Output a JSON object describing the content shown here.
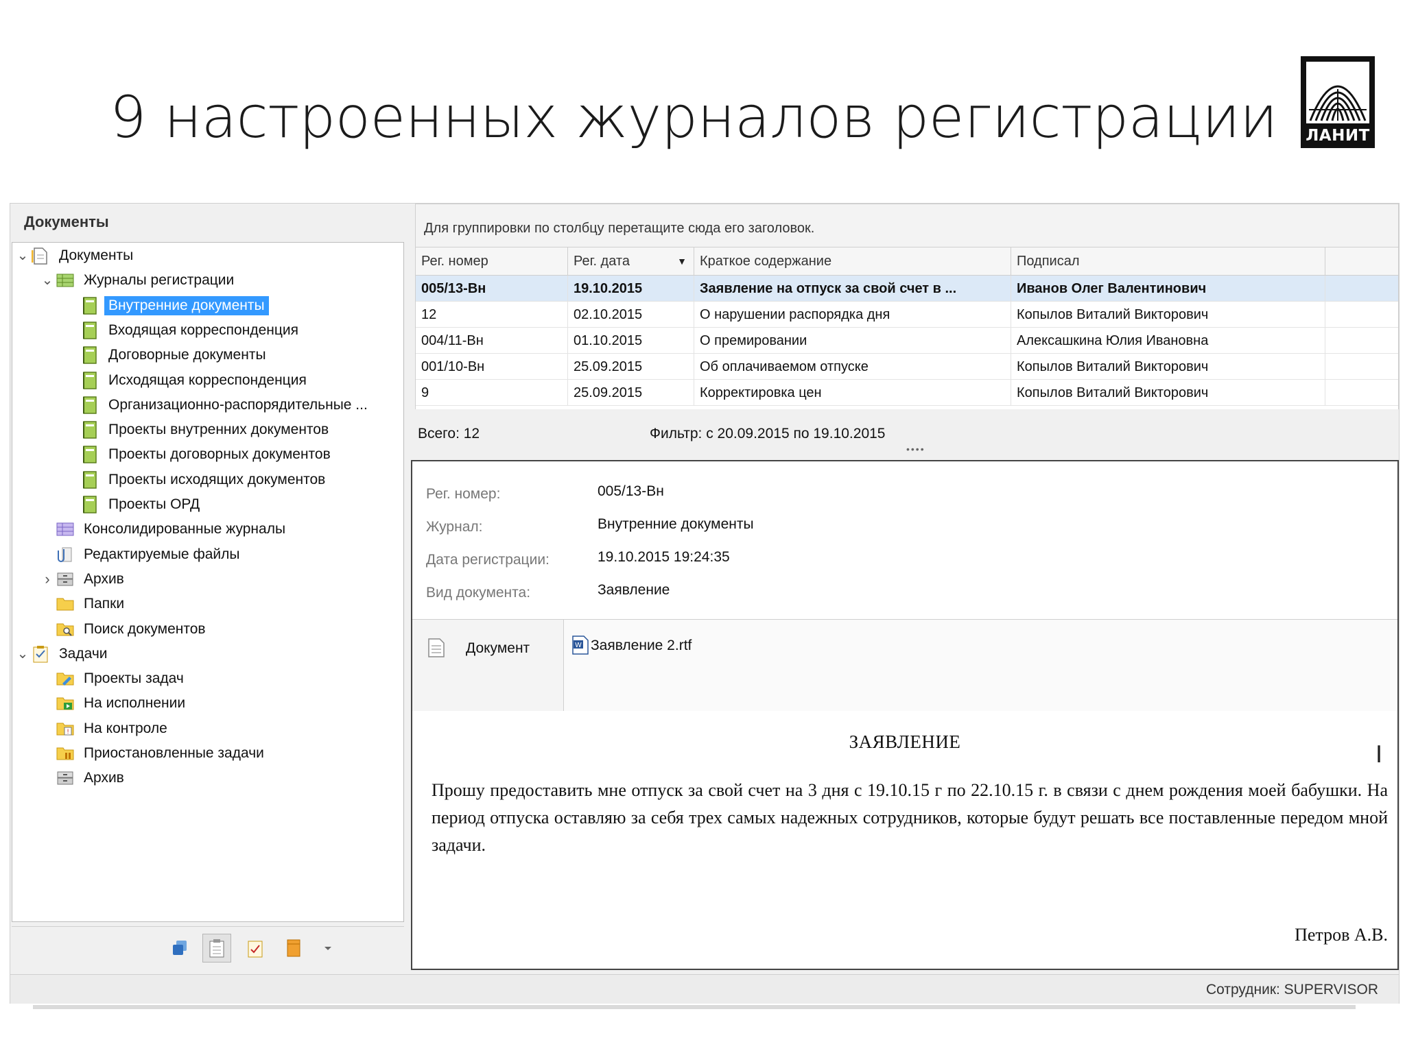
{
  "slide": {
    "title": "9 настроенных журналов регистрации"
  },
  "logo": {
    "text": "ЛАНИТ"
  },
  "app": {
    "left_panel": {
      "title": "Документы",
      "tree": [
        {
          "label": "Документы",
          "level": 0,
          "expander": "expanded",
          "icon": "documents-icon"
        },
        {
          "label": "Журналы регистрации",
          "level": 1,
          "expander": "expanded",
          "icon": "registration-journals-icon"
        },
        {
          "label": "Внутренние документы",
          "level": 2,
          "expander": "none",
          "icon": "journal-icon",
          "selected": true
        },
        {
          "label": "Входящая корреспонденция",
          "level": 2,
          "expander": "none",
          "icon": "journal-icon"
        },
        {
          "label": "Договорные документы",
          "level": 2,
          "expander": "none",
          "icon": "journal-icon"
        },
        {
          "label": "Исходящая корреспонденция",
          "level": 2,
          "expander": "none",
          "icon": "journal-icon"
        },
        {
          "label": "Организационно-распорядительные ...",
          "level": 2,
          "expander": "none",
          "icon": "journal-icon"
        },
        {
          "label": "Проекты внутренних документов",
          "level": 2,
          "expander": "none",
          "icon": "journal-icon"
        },
        {
          "label": "Проекты договорных документов",
          "level": 2,
          "expander": "none",
          "icon": "journal-icon"
        },
        {
          "label": "Проекты исходящих документов",
          "level": 2,
          "expander": "none",
          "icon": "journal-icon"
        },
        {
          "label": "Проекты ОРД",
          "level": 2,
          "expander": "none",
          "icon": "journal-icon"
        },
        {
          "label": "Консолидированные журналы",
          "level": 1,
          "expander": "none",
          "icon": "consolidated-journals-icon"
        },
        {
          "label": "Редактируемые файлы",
          "level": 1,
          "expander": "none",
          "icon": "paperclip-icon"
        },
        {
          "label": "Архив",
          "level": 1,
          "expander": "collapsed",
          "icon": "archive-icon"
        },
        {
          "label": "Папки",
          "level": 1,
          "expander": "none",
          "icon": "folder-icon"
        },
        {
          "label": "Поиск документов",
          "level": 1,
          "expander": "none",
          "icon": "folder-search-icon"
        },
        {
          "label": "Задачи",
          "level": 0,
          "expander": "expanded",
          "icon": "tasks-icon"
        },
        {
          "label": "Проекты задач",
          "level": 1,
          "expander": "none",
          "icon": "folder-edit-icon"
        },
        {
          "label": "На исполнении",
          "level": 1,
          "expander": "none",
          "icon": "folder-play-icon"
        },
        {
          "label": "На контроле",
          "level": 1,
          "expander": "none",
          "icon": "folder-control-icon"
        },
        {
          "label": "Приостановленные задачи",
          "level": 1,
          "expander": "none",
          "icon": "folder-pause-icon"
        },
        {
          "label": "Архив",
          "level": 1,
          "expander": "none",
          "icon": "archive-icon"
        }
      ],
      "toolbar": [
        {
          "icon": "windows-icon"
        },
        {
          "icon": "clipboard-icon",
          "active": true
        },
        {
          "icon": "tasks-icon"
        },
        {
          "icon": "book-icon"
        },
        {
          "icon": "dropdown-arrow-icon"
        }
      ]
    },
    "grid": {
      "group_hint": "Для группировки по столбцу перетащите сюда его заголовок.",
      "columns": [
        "Рег. номер",
        "Рег. дата",
        "Краткое содержание",
        "Подписал"
      ],
      "rows": [
        [
          "005/13-Вн",
          "19.10.2015",
          "Заявление на отпуск за свой счет в ...",
          "Иванов Олег Валентинович"
        ],
        [
          "12",
          "02.10.2015",
          "О нарушении распорядка дня",
          "Копылов Виталий Викторович"
        ],
        [
          "004/11-Вн",
          "01.10.2015",
          "О премировании",
          "Алексашкина Юлия Ивановна"
        ],
        [
          "001/10-Вн",
          "25.09.2015",
          "Об оплачиваемом отпуске",
          "Копылов Виталий Викторович"
        ],
        [
          "9",
          "25.09.2015",
          "Корректировка цен",
          "Копылов Виталий Викторович"
        ]
      ],
      "selected_row": 0,
      "total": "Всего: 12",
      "filter": "Фильтр: с 20.09.2015 по 19.10.2015"
    },
    "details": {
      "fields": [
        {
          "label": "Рег. номер:",
          "value": "005/13-Вн"
        },
        {
          "label": "Журнал:",
          "value": "Внутренние документы"
        },
        {
          "label": "Дата регистрации:",
          "value": "19.10.2015 19:24:35"
        },
        {
          "label": "Вид документа:",
          "value": "Заявление"
        }
      ],
      "attachment_label": "Документ",
      "file_name": "Заявление 2.rtf"
    },
    "document": {
      "title": "ЗАЯВЛЕНИЕ",
      "body": "Прошу предоставить мне отпуск за свой счет на 3 дня с 19.10.15 г по 22.10.15 г. в связи с днем рождения моей бабушки. На период отпуска оставляю за себя трех самых надежных сотрудников, которые будут решать все поставленные передом мной задачи.",
      "signature": "Петров А.В."
    },
    "status_bar": {
      "text": "Сотрудник: SUPERVISOR"
    }
  },
  "colors": {
    "selection": "#3399ff",
    "selected_row": "#dce9f7",
    "journal_icon": "#8bbf3c",
    "folder": "#f4c430"
  }
}
